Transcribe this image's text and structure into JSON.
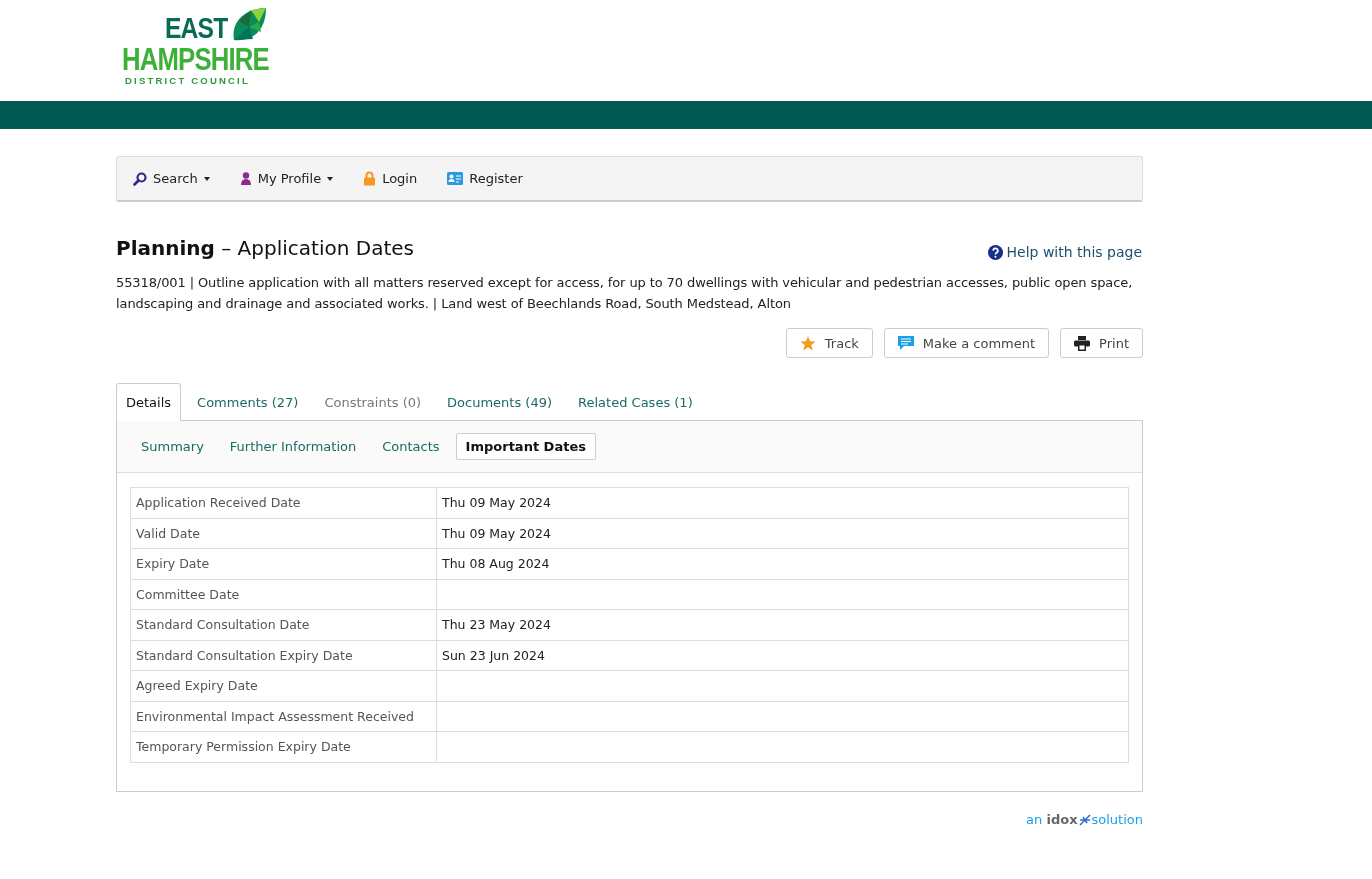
{
  "logo": {
    "line_1": "EAST",
    "line_2": "HAMPSHIRE",
    "line_3": "DISTRICT COUNCIL"
  },
  "nav": [
    {
      "kind": "search",
      "label": "Search",
      "dropdown": true
    },
    {
      "kind": "profile",
      "label": "My Profile",
      "dropdown": true
    },
    {
      "kind": "login",
      "label": "Login",
      "dropdown": false
    },
    {
      "kind": "register",
      "label": "Register",
      "dropdown": false
    }
  ],
  "page_title": "**Planning** – Application Dates",
  "help_link": "Help with this page",
  "description": "55318/001 | Outline application with all matters reserved except for access, for up to 70 dwellings with vehicular and pedestrian accesses, public open space, landscaping and drainage and associated works. | Land west of Beechlands Road, South Medstead, Alton",
  "actions": [
    {
      "kind": "track",
      "label": "Track"
    },
    {
      "kind": "comment",
      "label": "Make a comment"
    },
    {
      "kind": "print",
      "label": "Print"
    }
  ],
  "tabs": [
    {
      "label": "Details",
      "selected": true,
      "disabled": false
    },
    {
      "label": "Comments (27)",
      "selected": false,
      "disabled": false
    },
    {
      "label": "Constraints (0)",
      "selected": false,
      "disabled": true
    },
    {
      "label": "Documents (49)",
      "selected": false,
      "disabled": false
    },
    {
      "label": "Related Cases (1)",
      "selected": false,
      "disabled": false
    }
  ],
  "subtabs": [
    {
      "label": "Summary",
      "selected": false
    },
    {
      "label": "Further Information",
      "selected": false
    },
    {
      "label": "Contacts",
      "selected": false
    },
    {
      "label": "Important Dates",
      "selected": true
    }
  ],
  "dates_table": {
    "rows": [
      {
        "label": "Application Received Date",
        "value": "Thu 09 May 2024"
      },
      {
        "label": "Valid Date",
        "value": "Thu 09 May 2024"
      },
      {
        "label": "Expiry Date",
        "value": "Thu 08 Aug 2024"
      },
      {
        "label": "Committee Date",
        "value": ""
      },
      {
        "label": "Standard Consultation Date",
        "value": "Thu 23 May 2024"
      },
      {
        "label": "Standard Consultation Expiry Date",
        "value": "Sun 23 Jun 2024"
      },
      {
        "label": "Agreed Expiry Date",
        "value": ""
      },
      {
        "label": "Environmental Impact Assessment Received",
        "value": ""
      },
      {
        "label": "Temporary Permission Expiry Date",
        "value": ""
      }
    ]
  },
  "footer": {
    "prefix": "an",
    "brand": "idox",
    "suffix": "solution"
  }
}
